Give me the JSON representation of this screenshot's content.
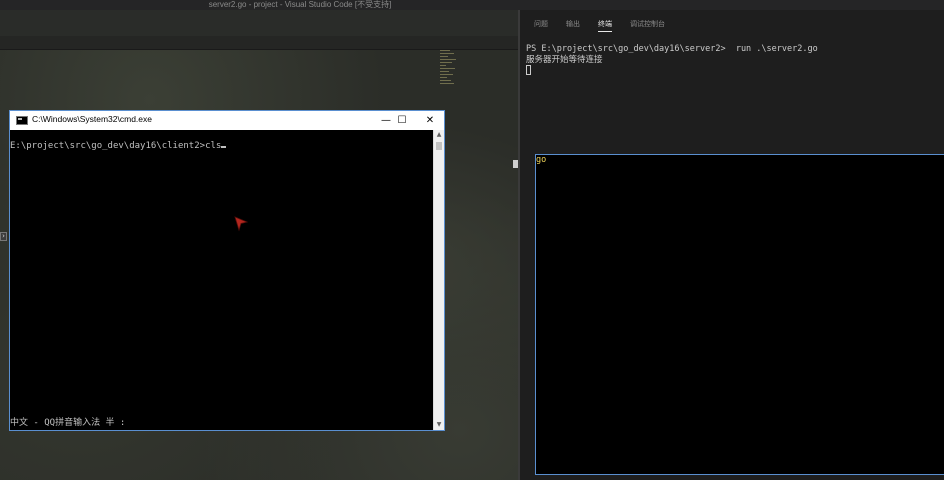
{
  "vscode": {
    "window_title": "server2.go - project - Visual Studio Code [不受支持]",
    "toolbar_icons": [
      "run-icon",
      "split-editor-icon",
      "more-actions-icon"
    ],
    "panel": {
      "tabs": [
        {
          "label": "问题",
          "active": false
        },
        {
          "label": "输出",
          "active": false
        },
        {
          "label": "终端",
          "active": true
        },
        {
          "label": "调试控制台",
          "active": false
        }
      ],
      "terminal": {
        "prompt": "PS E:\\project\\src\\go_dev\\day16\\server2> ",
        "command": "go",
        "args": " run .\\server2.go",
        "output_line": "服务器开始等待连接"
      }
    }
  },
  "cmd_window": {
    "title": "C:\\Windows\\System32\\cmd.exe",
    "minimize_label": "—",
    "maximize_label": "☐",
    "close_label": "✕",
    "prompt_line": "E:\\project\\src\\go_dev\\day16\\client2>cls",
    "ime_status": "中文 - QQ拼音输入法 半 :"
  },
  "colors": {
    "vscode_bg": "#1e1e1e",
    "terminal_command": "#f1d65b",
    "cmd_bg": "#000000",
    "cmd_border": "#5a8fd0"
  }
}
